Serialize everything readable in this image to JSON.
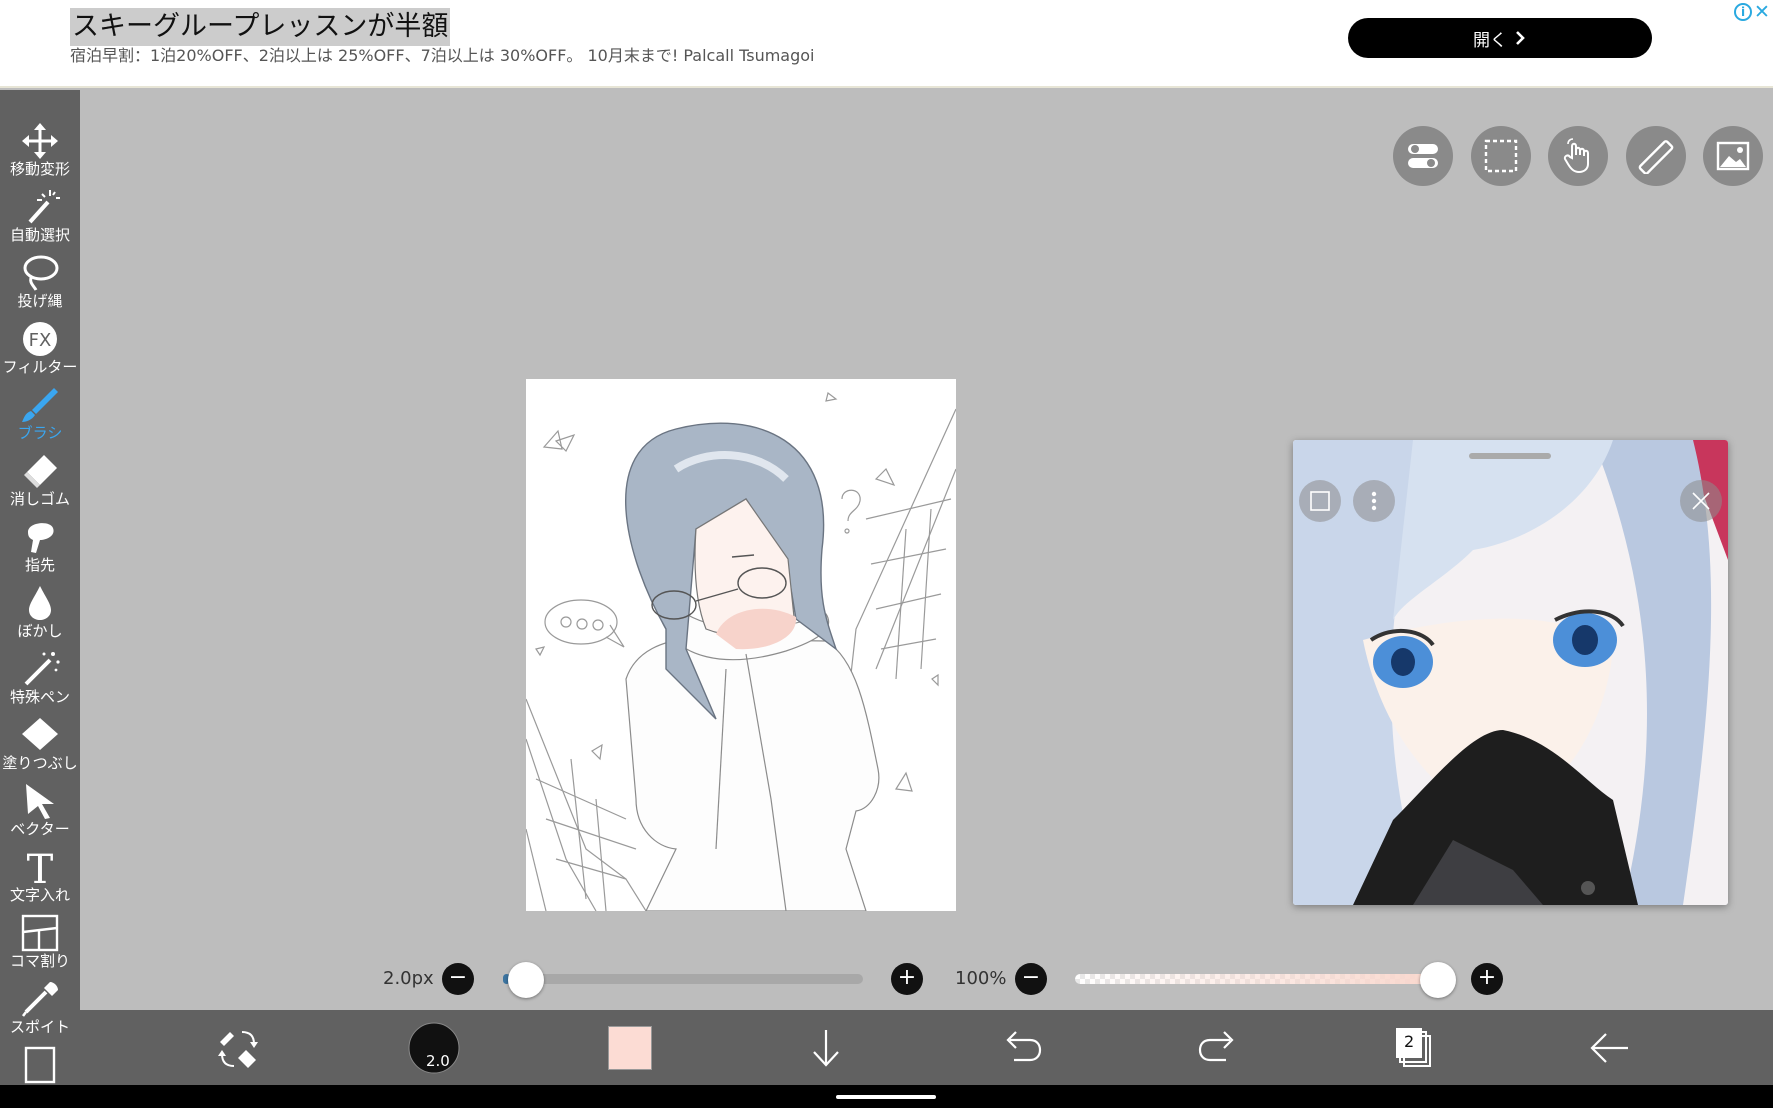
{
  "ad": {
    "title": "スキーグループレッスンが半額",
    "subtitle": "宿泊早割：1泊20%OFF、2泊以上は 25%OFF、7泊以上は 30%OFF。 10月末まで! Palcall Tsumagoi",
    "open_label": "開く",
    "info_icon": "info-icon",
    "close_icon": "close-icon"
  },
  "left_toolbar": {
    "tools": [
      {
        "label": "移動変形",
        "icon": "move-transform-icon"
      },
      {
        "label": "自動選択",
        "icon": "magic-wand-icon"
      },
      {
        "label": "投げ縄",
        "icon": "lasso-icon"
      },
      {
        "label": "フィルター",
        "icon": "fx-icon"
      },
      {
        "label": "ブラシ",
        "icon": "brush-icon",
        "active": true
      },
      {
        "label": "消しゴム",
        "icon": "eraser-icon"
      },
      {
        "label": "指先",
        "icon": "finger-icon"
      },
      {
        "label": "ぼかし",
        "icon": "blur-drop-icon"
      },
      {
        "label": "特殊ペン",
        "icon": "special-pen-icon"
      },
      {
        "label": "塗りつぶし",
        "icon": "fill-bucket-icon"
      },
      {
        "label": "ベクター",
        "icon": "vector-cursor-icon"
      },
      {
        "label": "文字入れ",
        "icon": "text-icon"
      },
      {
        "label": "コマ割り",
        "icon": "frame-divider-icon"
      },
      {
        "label": "スポイト",
        "icon": "eyedropper-icon"
      }
    ],
    "accent_color": "#3aa6f0"
  },
  "top_buttons": [
    "toggle-icon",
    "selection-icon",
    "hand-icon",
    "ruler-icon",
    "image-icon"
  ],
  "canvas": {
    "background": "#ffffff"
  },
  "reference_window": {
    "buttons": [
      "square-icon",
      "more-icon",
      "close-icon"
    ]
  },
  "brush_size": {
    "label": "2.0px",
    "value": 2.0,
    "fraction": 0.02
  },
  "opacity": {
    "label": "100%",
    "value": 100
  },
  "bottom_toolbar": {
    "brush_size_badge": "2.0",
    "current_color": "#fcdcd4",
    "layer_count": "2",
    "icons": [
      "brush-eraser-swap-icon",
      "brush-size-icon",
      "color-swatch",
      "arrow-down-icon",
      "undo-icon",
      "redo-icon",
      "layers-icon",
      "back-arrow-icon"
    ]
  }
}
